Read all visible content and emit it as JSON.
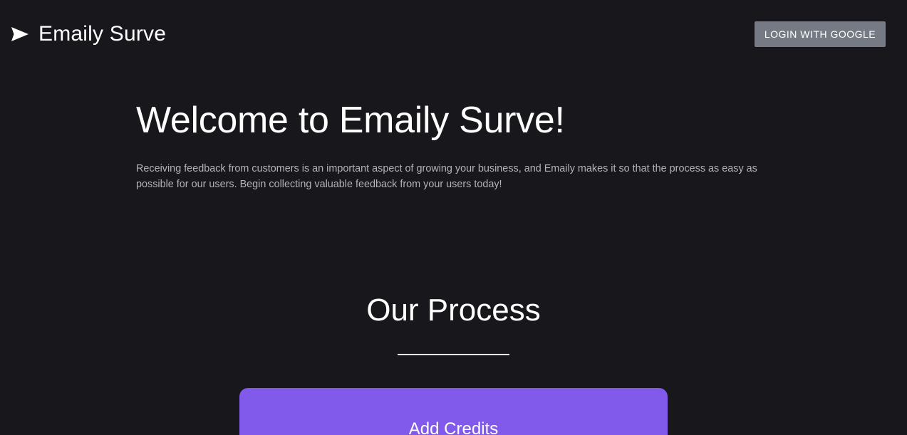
{
  "header": {
    "brand_icon": "paper-plane-icon",
    "brand_name": "Emaily Surve",
    "login_label": "LOGIN WITH GOOGLE"
  },
  "hero": {
    "title": "Welcome to Emaily Surve!",
    "description": "Receiving feedback from customers is an important aspect of growing your business, and Emaily makes it so that the process as easy as possible for our users. Begin collecting valuable feedback from your users today!"
  },
  "process": {
    "title": "Our Process",
    "steps": [
      {
        "label": "Add Credits"
      }
    ]
  },
  "colors": {
    "background": "#18171c",
    "login_button": "#767a84",
    "accent": "#8159eb",
    "muted_text": "#b4b3ba"
  }
}
